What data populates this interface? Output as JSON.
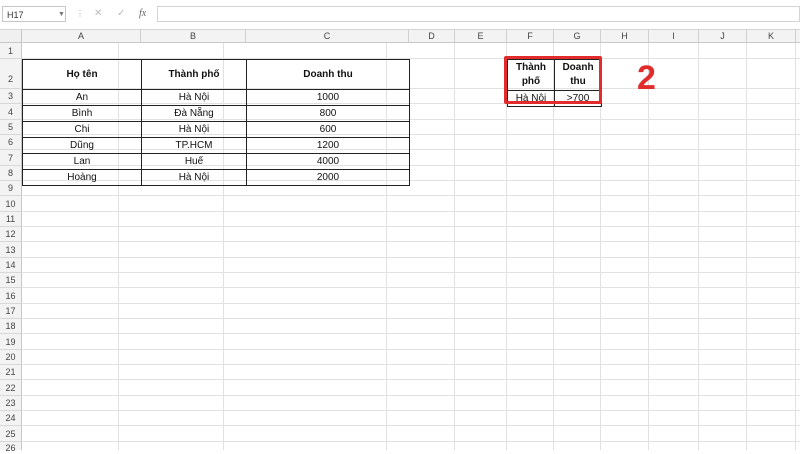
{
  "formula_bar": {
    "name_box": "H17",
    "name_box_arrow_icon": "chevron-down-icon",
    "cancel_icon": "✕",
    "enter_icon": "✓",
    "function_label": "fx",
    "formula_value": ""
  },
  "columns": [
    "A",
    "B",
    "C",
    "D",
    "E",
    "F",
    "G",
    "H",
    "I",
    "J",
    "K"
  ],
  "rows": [
    "1",
    "2",
    "3",
    "4",
    "5",
    "6",
    "7",
    "8",
    "9",
    "10",
    "11",
    "12",
    "13",
    "14",
    "15",
    "16",
    "17",
    "18",
    "19",
    "20",
    "21",
    "22",
    "23",
    "24",
    "25",
    "26"
  ],
  "data_table": {
    "headers": [
      "Họ tên",
      "Thành phố",
      "Doanh thu"
    ],
    "rows": [
      [
        "An",
        "Hà Nội",
        "1000"
      ],
      [
        "Bình",
        "Đà Nẵng",
        "800"
      ],
      [
        "Chi",
        "Hà Nội",
        "600"
      ],
      [
        "Dũng",
        "TP.HCM",
        "1200"
      ],
      [
        "Lan",
        "Huế",
        "4000"
      ],
      [
        "Hoàng",
        "Hà Nội",
        "2000"
      ]
    ]
  },
  "criteria_table": {
    "headers": [
      [
        "Thành",
        "phố"
      ],
      [
        "Doanh",
        "thu"
      ]
    ],
    "values": [
      "Hà Nội",
      ">700"
    ]
  },
  "annotation": {
    "label": "2",
    "color": "#e22b2b"
  }
}
